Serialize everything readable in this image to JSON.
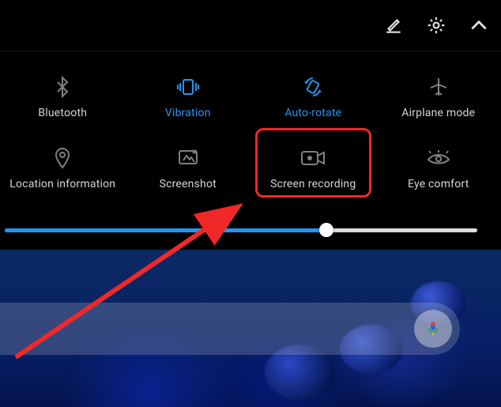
{
  "header": {
    "edit_icon": "edit-icon",
    "settings_icon": "gear-icon",
    "collapse_icon": "chevron-up-icon"
  },
  "tiles": [
    {
      "id": "bluetooth",
      "label": "Bluetooth",
      "active": false,
      "icon": "bluetooth-icon"
    },
    {
      "id": "vibration",
      "label": "Vibration",
      "active": true,
      "icon": "vibration-icon"
    },
    {
      "id": "autorotate",
      "label": "Auto-rotate",
      "active": true,
      "icon": "autorotate-icon"
    },
    {
      "id": "airplane",
      "label": "Airplane mode",
      "active": false,
      "icon": "airplane-icon"
    },
    {
      "id": "location",
      "label": "Location information",
      "active": false,
      "icon": "location-icon"
    },
    {
      "id": "screenshot",
      "label": "Screenshot",
      "active": false,
      "icon": "screenshot-icon"
    },
    {
      "id": "screenrecording",
      "label": "Screen recording",
      "active": false,
      "icon": "screenrecord-icon"
    },
    {
      "id": "eyecomfort",
      "label": "Eye comfort",
      "active": false,
      "icon": "eye-icon"
    }
  ],
  "brightness": {
    "value": 68
  },
  "highlight": {
    "target_tile": "screenrecording"
  },
  "annotation": {
    "arrow_color": "#f02828"
  },
  "colors": {
    "active": "#2196f3",
    "inactive": "#808080",
    "text_inactive": "#d5d5d5",
    "highlight": "#f02828"
  },
  "search": {
    "mic_icon": "microphone-icon"
  }
}
